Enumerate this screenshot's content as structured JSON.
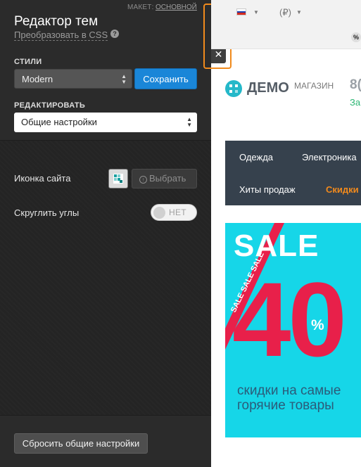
{
  "editor": {
    "layout_label": "МАКЕТ:",
    "layout_value": "ОСНОВНОЙ",
    "title": "Редактор тем",
    "convert_link": "Преобразовать в CSS",
    "help_icon": "?",
    "styles_label": "СТИЛИ",
    "style_selected": "Modern",
    "save_button": "Сохранить",
    "edit_label": "РЕДАКТИРОВАТЬ",
    "edit_selected": "Общие настройки",
    "favicon_label": "Иконка сайта",
    "choose_button": "Выбрать",
    "round_corners_label": "Скруглить углы",
    "toggle_state": "НЕТ",
    "reset_button": "Сбросить общие настройки",
    "collapse_glyph": "‹",
    "close_glyph": "✕"
  },
  "store": {
    "currency": "(₽)",
    "percent_badge": "%",
    "logo_text": "ДЕМО",
    "logo_sub": "МАГАЗИН",
    "phone_partial": "8(",
    "callback_partial": "За",
    "menu": {
      "item1": "Одежда",
      "item2": "Электроника",
      "item3": "Хиты продаж",
      "item4": "Скидки"
    },
    "banner": {
      "title": "SALE",
      "ribbon": "SALE SALE SALE",
      "number": "40",
      "percent": "%",
      "line1": "скидки на самые",
      "line2": "горячие товары"
    }
  },
  "colors": {
    "accent_orange": "#f08a1c",
    "save_blue": "#1a86d8",
    "banner_cyan": "#16d6e8",
    "banner_red": "#e8204a",
    "menu_bg": "#36414d"
  },
  "icons": [
    "help-icon",
    "chevron-left-icon",
    "close-icon",
    "upload-icon",
    "russia-flag-icon",
    "caret-down-icon",
    "logo-icon"
  ]
}
